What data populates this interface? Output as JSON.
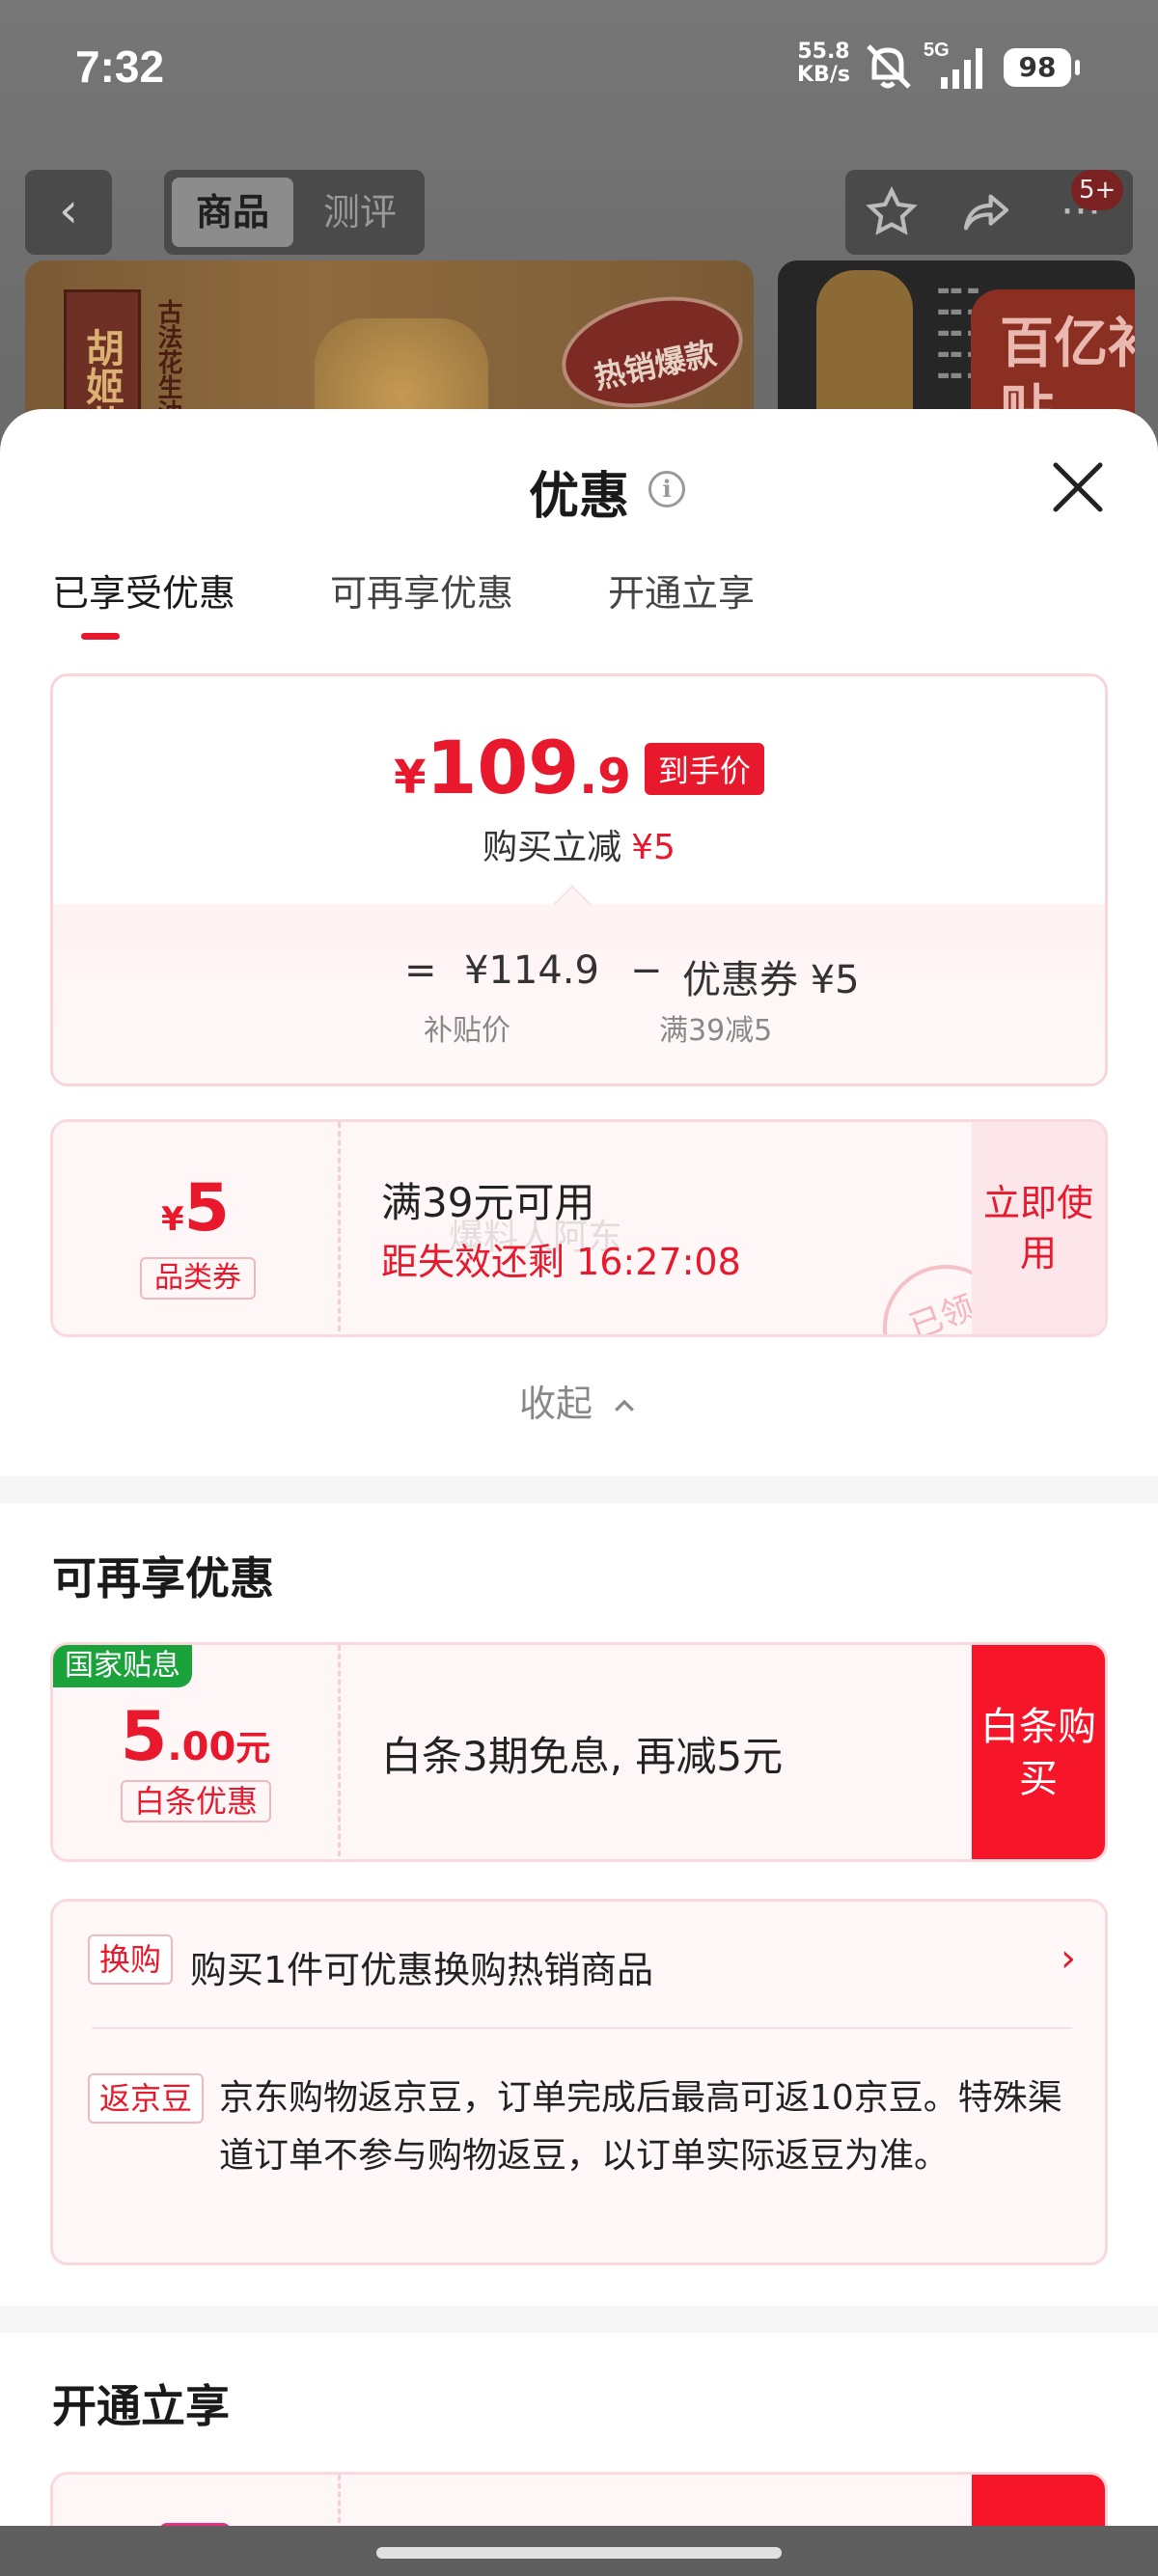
{
  "status_bar": {
    "time": "7:32",
    "net_speed": "55.8",
    "net_unit": "KB/s",
    "signal_type": "5G",
    "battery": "98"
  },
  "nav": {
    "tab_product": "商品",
    "tab_review": "测评",
    "badge": "5+"
  },
  "background_images": {
    "brand_name": "胡姬花",
    "brand_sub": "古法花生油",
    "seal_text": "热销爆款",
    "side_banner": "百亿补贴"
  },
  "sheet": {
    "title": "优惠",
    "tabs": [
      "已享受优惠",
      "可再享优惠",
      "开通立享"
    ],
    "hand_price": {
      "currency": "¥",
      "integer": "109",
      "decimal": ".9",
      "tag": "到手价"
    },
    "reduction": {
      "label": "购买立减",
      "amount": "¥5"
    },
    "formula": {
      "equals": "=",
      "subsidy_price": "¥114.9",
      "minus": "−",
      "coupon": "优惠券 ¥5",
      "subsidy_label": "补贴价",
      "coupon_label": "满39减5"
    },
    "coupon": {
      "currency": "¥",
      "value": "5",
      "type": "品类券",
      "title": "满39元可用",
      "countdown": "距失效还剩 16:27:08",
      "watermark": "爆料人阿东",
      "stamp": "已领",
      "action": "立即使用"
    },
    "collapse_label": "收起",
    "section_more": {
      "title": "可再享优惠"
    },
    "baitiao": {
      "tag": "国家贴息",
      "value": "5",
      "decimal": ".00",
      "unit": "元",
      "type": "白条优惠",
      "text": "白条3期免息, 再减5元",
      "action": "白条购买"
    },
    "exchange": {
      "tag": "换购",
      "text": "购买1件可优惠换购热销商品"
    },
    "jingdou": {
      "tag": "返京豆",
      "text": "京东购物返京豆，订单完成后最高可返10京豆。特殊渠道订单不参与购物返豆，以订单实际返豆为准。"
    },
    "section_open": {
      "title": "开通立享"
    }
  },
  "colors": {
    "accent": "#e8192c",
    "gov_green": "#1aa33a"
  }
}
